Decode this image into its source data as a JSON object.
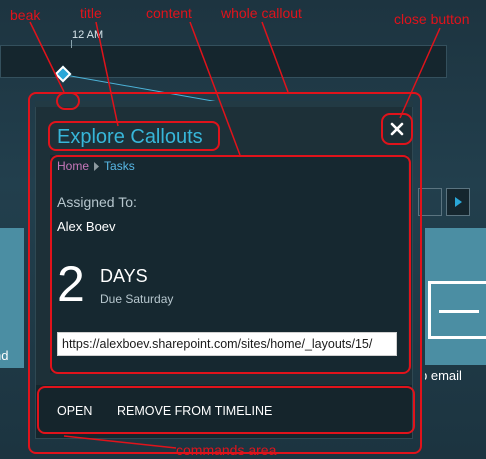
{
  "timeline": {
    "time_label": "12 AM"
  },
  "background_tiles": {
    "left_text": "nd",
    "right_text": "p email"
  },
  "callout": {
    "title": "Explore Callouts",
    "close_icon": "close-icon",
    "breadcrumb": {
      "home": "Home",
      "tasks": "Tasks"
    },
    "assigned_label": "Assigned To:",
    "assignee": "Alex Boev",
    "days_number": "2",
    "days_label": "DAYS",
    "due_text": "Due Saturday",
    "url_value": "https://alexboev.sharepoint.com/sites/home/_layouts/15/",
    "commands": {
      "open": "OPEN",
      "remove": "REMOVE FROM TIMELINE"
    }
  },
  "annotations": {
    "beak": "beak",
    "title": "title",
    "content": "content",
    "whole_callout": "whole callout",
    "close_button": "close button",
    "commands_area": "commands area"
  },
  "colors": {
    "accent": "#37b6d9",
    "annotation": "#e0131b",
    "home_link": "#c777ba",
    "tasks_link": "#58b8e6"
  }
}
